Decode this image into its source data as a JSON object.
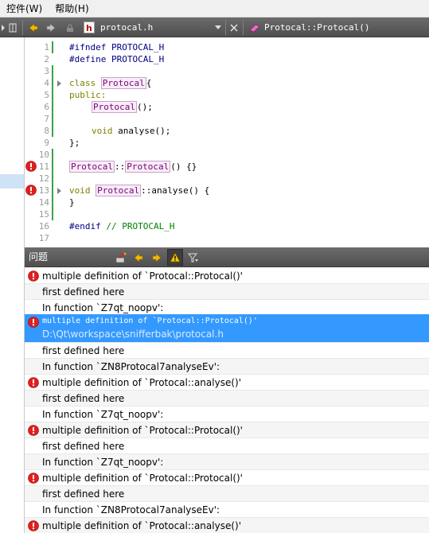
{
  "menubar": {
    "items": [
      "控件(W)",
      "帮助(H)"
    ]
  },
  "toolbar": {
    "file_name": "protocal.h",
    "file_icon_letter": "h",
    "symbol_name": "Protocal::Protocal()"
  },
  "editor": {
    "line_numbers": [
      "1",
      "2",
      "3",
      "4",
      "5",
      "6",
      "7",
      "8",
      "9",
      "10",
      "11",
      "12",
      "13",
      "14",
      "15",
      "16",
      "17"
    ],
    "lines": {
      "l1": "#ifndef PROTOCAL_H",
      "l2": "#define PROTOCAL_H",
      "l4_kw": "class ",
      "l4_name": "Protocal",
      "l4_rest": "{",
      "l5": "public:",
      "l6_name": "Protocal",
      "l6_rest": "();",
      "l8_kw": "void ",
      "l8_rest": "analyse();",
      "l9": "};",
      "l11_name1": "Protocal",
      "l11_sep": "::",
      "l11_name2": "Protocal",
      "l11_rest": "() {}",
      "l13_kw": "void ",
      "l13_name": "Protocal",
      "l13_rest": "::analyse() {",
      "l14": "}",
      "l16_pp": "#endif ",
      "l16_cm": "// PROTOCAL_H"
    }
  },
  "issues": {
    "title": "问题",
    "rows": [
      {
        "text": "multiple definition of `Protocal::Protocal()'",
        "error": true
      },
      {
        "text": "first defined here",
        "error": false
      },
      {
        "text": "In function `Z7qt_noopv':",
        "error": false
      },
      {
        "text": "multiple definition of `Protocal::Protocal()'",
        "path": "D:\\Qt\\workspace\\snifferbak\\protocal.h",
        "error": true,
        "selected": true
      },
      {
        "text": "first defined here",
        "error": false
      },
      {
        "text": "In function `ZN8Protocal7analyseEv':",
        "error": false
      },
      {
        "text": "multiple definition of `Protocal::analyse()'",
        "error": true
      },
      {
        "text": "first defined here",
        "error": false
      },
      {
        "text": "In function `Z7qt_noopv':",
        "error": false
      },
      {
        "text": "multiple definition of `Protocal::Protocal()'",
        "error": true
      },
      {
        "text": "first defined here",
        "error": false
      },
      {
        "text": "In function `Z7qt_noopv':",
        "error": false
      },
      {
        "text": "multiple definition of `Protocal::Protocal()'",
        "error": true
      },
      {
        "text": "first defined here",
        "error": false
      },
      {
        "text": "In function `ZN8Protocal7analyseEv':",
        "error": false
      },
      {
        "text": "multiple definition of `Protocal::analyse()'",
        "error": true
      }
    ]
  },
  "colors": {
    "error_red": "#e02020",
    "selection_blue": "#3399ff",
    "toolbar_dark": "#5a5a5a",
    "change_marker_green": "#3aa34a"
  }
}
